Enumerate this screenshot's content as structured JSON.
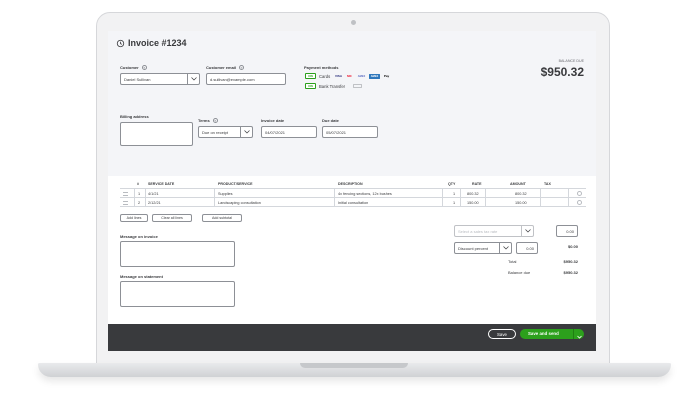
{
  "invoice": {
    "title": "Invoice #1234",
    "balance_due_label": "BALANCE DUE",
    "balance_due_value": "$950.32"
  },
  "customer": {
    "label": "Customer",
    "value": "Daniel Sullivan",
    "email_label": "Customer email",
    "email_value": "d.sullivan@example.com"
  },
  "payment": {
    "label": "Payment methods",
    "badge": "ON",
    "cards_label": "Cards",
    "bank_label": "Bank Transfer",
    "card_brands": [
      "VISA",
      "MC",
      "AMEX",
      "AMEX",
      "Pay"
    ]
  },
  "billing": {
    "label": "Billing address"
  },
  "terms": {
    "label": "Terms",
    "value": "Due on receipt"
  },
  "invoice_date": {
    "label": "Invoice date",
    "value": "04/07/2021"
  },
  "due_date": {
    "label": "Due date",
    "value": "05/07/2021"
  },
  "table": {
    "headers": [
      "#",
      "SERVICE DATE",
      "PRODUCT/SERVICE",
      "DESCRIPTION",
      "QTY",
      "RATE",
      "AMOUNT",
      "TAX"
    ],
    "rows": [
      {
        "num": "1",
        "date": "4/1/21",
        "product": "Supplies",
        "description": "4x fencing sections, 12x bushes",
        "qty": "1",
        "rate": "800.32",
        "amount": "800.32"
      },
      {
        "num": "2",
        "date": "2/12/21",
        "product": "Landscaping consultation",
        "description": "Initial consultation",
        "qty": "1",
        "rate": "150.00",
        "amount": "150.00"
      }
    ]
  },
  "buttons": {
    "add_lines": "Add lines",
    "clear_all": "Clear all lines",
    "add_subtotal": "Add subtotal",
    "save": "Save",
    "save_and_send": "Save and send"
  },
  "messages": {
    "invoice_label": "Message on invoice",
    "statement_label": "Message on statement"
  },
  "summary": {
    "tax_placeholder": "Select a sales tax rate",
    "tax_value": "0.00",
    "discount_select": "Discount percent",
    "discount_input": "0.00",
    "discount_value": "$0.00",
    "total_label": "Total",
    "total_value": "$950.32",
    "balance_label": "Balance due",
    "balance_value": "$950.32"
  },
  "colors": {
    "accent_green": "#2ca01c",
    "footer_dark": "#393a3d",
    "text": "#393a3d"
  }
}
